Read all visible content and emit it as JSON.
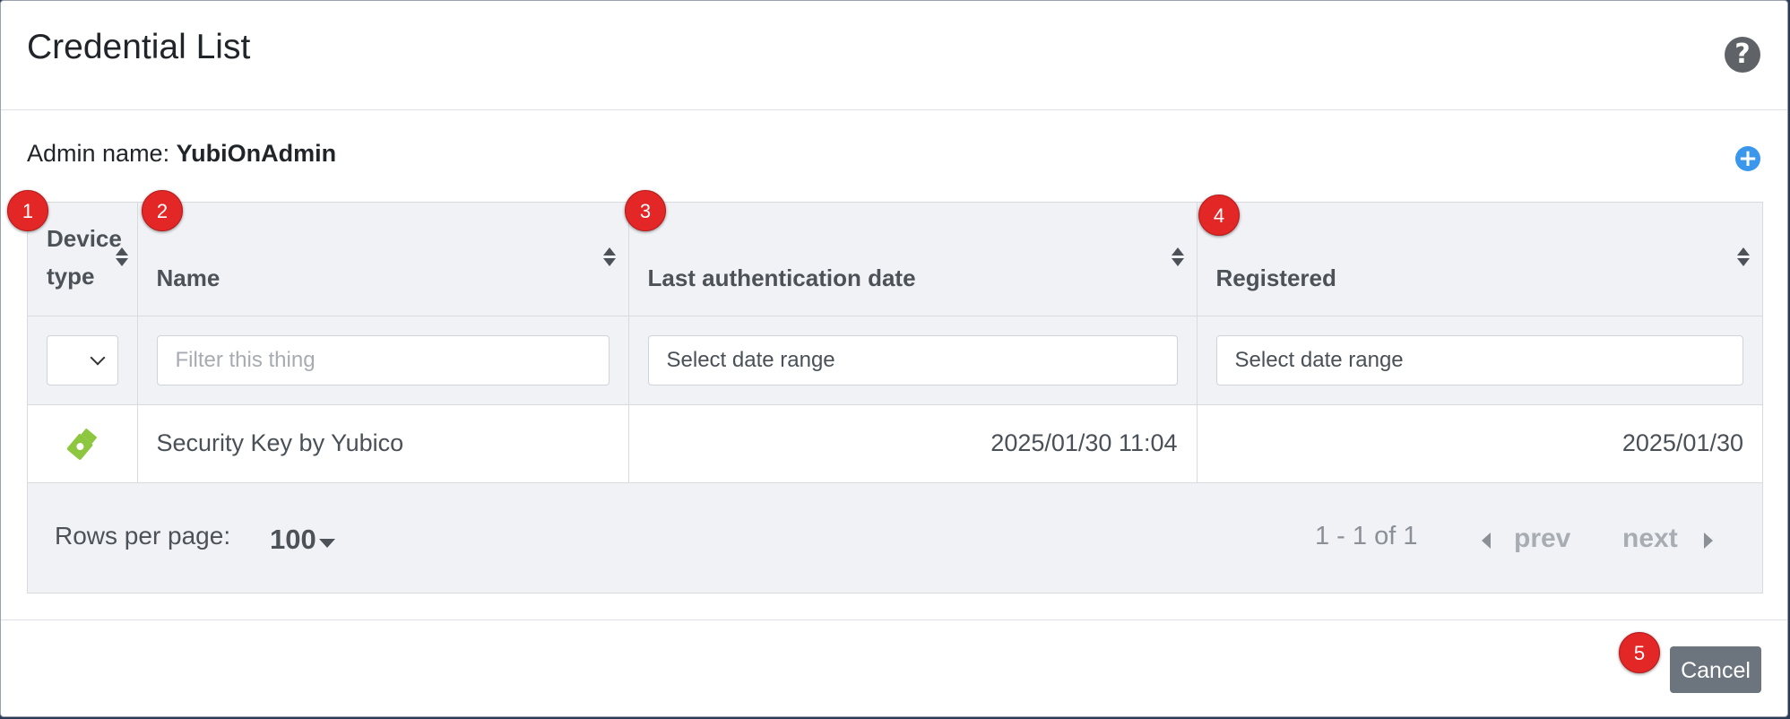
{
  "dialog": {
    "title": "Credential List",
    "help_icon": "question-circle-icon",
    "admin_label": "Admin name: ",
    "admin_value": "YubiOnAdmin",
    "add_icon": "plus-circle-icon"
  },
  "table": {
    "columns": [
      {
        "label": "Device type"
      },
      {
        "label": "Name"
      },
      {
        "label": "Last authentication date"
      },
      {
        "label": "Registered"
      }
    ],
    "filters": {
      "device_type_selected": "",
      "name_placeholder": "Filter this thing",
      "last_auth_placeholder": "Select date range",
      "registered_placeholder": "Select date range"
    },
    "rows": [
      {
        "device_icon": "usb-key-icon",
        "name": "Security Key by Yubico",
        "last_auth": "2025/01/30 11:04",
        "registered": "2025/01/30"
      }
    ]
  },
  "pagination": {
    "rows_per_page_label": "Rows per page:",
    "rows_per_page_value": "100",
    "page_info": "1 - 1 of 1",
    "prev_label": "prev",
    "next_label": "next"
  },
  "footer": {
    "cancel_label": "Cancel"
  },
  "annotations": [
    "1",
    "2",
    "3",
    "4",
    "5"
  ],
  "colors": {
    "badge": "#e32626",
    "key_icon": "#8dc63f",
    "add_icon": "#3b97ec",
    "cancel_button": "#6c757d"
  }
}
